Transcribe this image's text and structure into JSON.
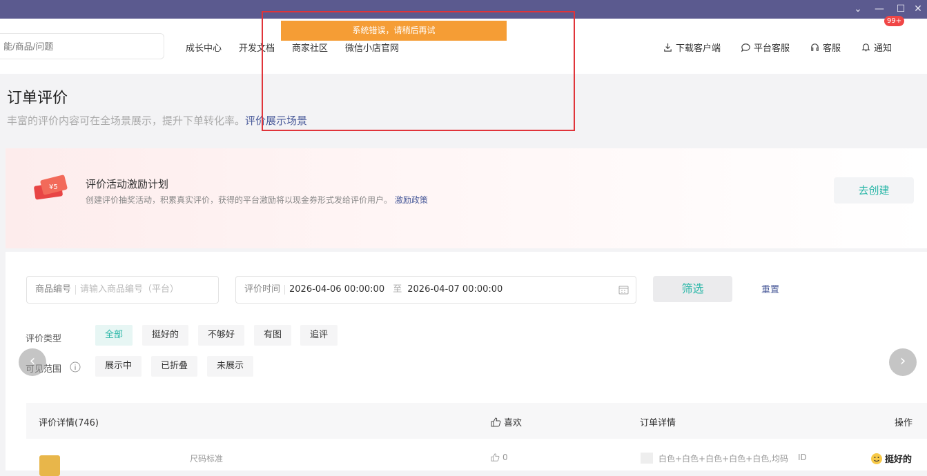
{
  "window": {
    "min": "—",
    "max": "☐",
    "close": "✕",
    "menu": "⌄"
  },
  "search": {
    "placeholder": "能/商品/问题"
  },
  "nav": {
    "links": [
      "成长中心",
      "开发文档",
      "商家社区",
      "微信小店官网"
    ]
  },
  "nav_right": {
    "download": "下载客户端",
    "platform_service": "平台客服",
    "service": "客服",
    "notify": "通知",
    "badge": "99+"
  },
  "toast": {
    "message": "系统错误，请稍后再试"
  },
  "page": {
    "title": "订单评价",
    "subtitle": "丰富的评价内容可在全场景展示，提升下单转化率。",
    "subtitle_link": "评价展示场景"
  },
  "promo": {
    "title": "评价活动激励计划",
    "desc": "创建评价抽奖活动，积累真实评价，获得的平台激励将以现金券形式发给评价用户。",
    "desc_link": "激励政策",
    "button": "去创建",
    "ticket": "¥5"
  },
  "filters": {
    "product_label": "商品编号",
    "product_placeholder": "请输入商品编号（平台）",
    "time_label": "评价时间",
    "start": "2026-04-06 00:00:00",
    "to": "至",
    "end": "2026-04-07 00:00:00",
    "filter_btn": "筛选",
    "reset": "重置"
  },
  "type_row": {
    "label": "评价类型",
    "chips": [
      "全部",
      "挺好的",
      "不够好",
      "有图",
      "追评"
    ]
  },
  "visible_row": {
    "label": "可见范围",
    "chips": [
      "展示中",
      "已折叠",
      "未展示"
    ]
  },
  "table": {
    "headers": {
      "detail": "评价详情(746)",
      "likes": "喜欢",
      "order": "订单详情",
      "ops": "操作"
    },
    "row": {
      "spec": "尺码标准",
      "likes": "0",
      "order": "白色+白色+白色+白色+白色,均码",
      "id": "ID",
      "rating": "挺好的"
    }
  },
  "colors": {
    "accent": "#2bb7a8",
    "link": "#4a5b9a",
    "toast": "#f59d35",
    "titlebar": "#5b5a8f",
    "alert_box": "#e0343a"
  }
}
